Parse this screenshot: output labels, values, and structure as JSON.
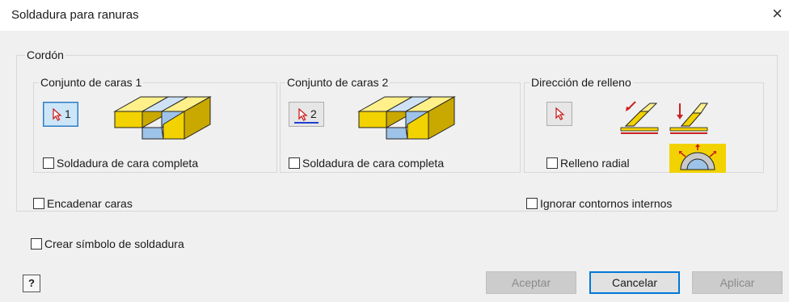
{
  "window": {
    "title": "Soldadura para ranuras",
    "close_glyph": "×"
  },
  "cordon": {
    "legend": "Cordón",
    "set1": {
      "legend": "Conjunto de caras 1",
      "select_number": "1",
      "checkbox_label": "Soldadura de cara completa",
      "checked": false
    },
    "set2": {
      "legend": "Conjunto de caras 2",
      "select_number": "2",
      "checkbox_label": "Soldadura de cara completa",
      "checked": false
    },
    "fill": {
      "legend": "Dirección de relleno",
      "radial_label": "Relleno radial",
      "radial_checked": false
    },
    "chain_faces_label": "Encadenar caras",
    "ignore_contours_label": "Ignorar contornos internos"
  },
  "create_symbol_label": "Crear símbolo de soldadura",
  "buttons": {
    "ok": "Aceptar",
    "cancel": "Cancelar",
    "apply": "Aplicar",
    "help": "?"
  },
  "colors": {
    "face_yellow": "#f2d200",
    "face_blue": "#9ec3e8",
    "accent": "#0078d7",
    "arrow_red": "#cc1f1f"
  },
  "icons": [
    "select-arrow-icon",
    "face-set-1-illustration",
    "face-set-2-illustration",
    "fill-direction-1-icon",
    "fill-direction-2-icon",
    "radial-fill-icon",
    "help-icon",
    "close-icon"
  ]
}
